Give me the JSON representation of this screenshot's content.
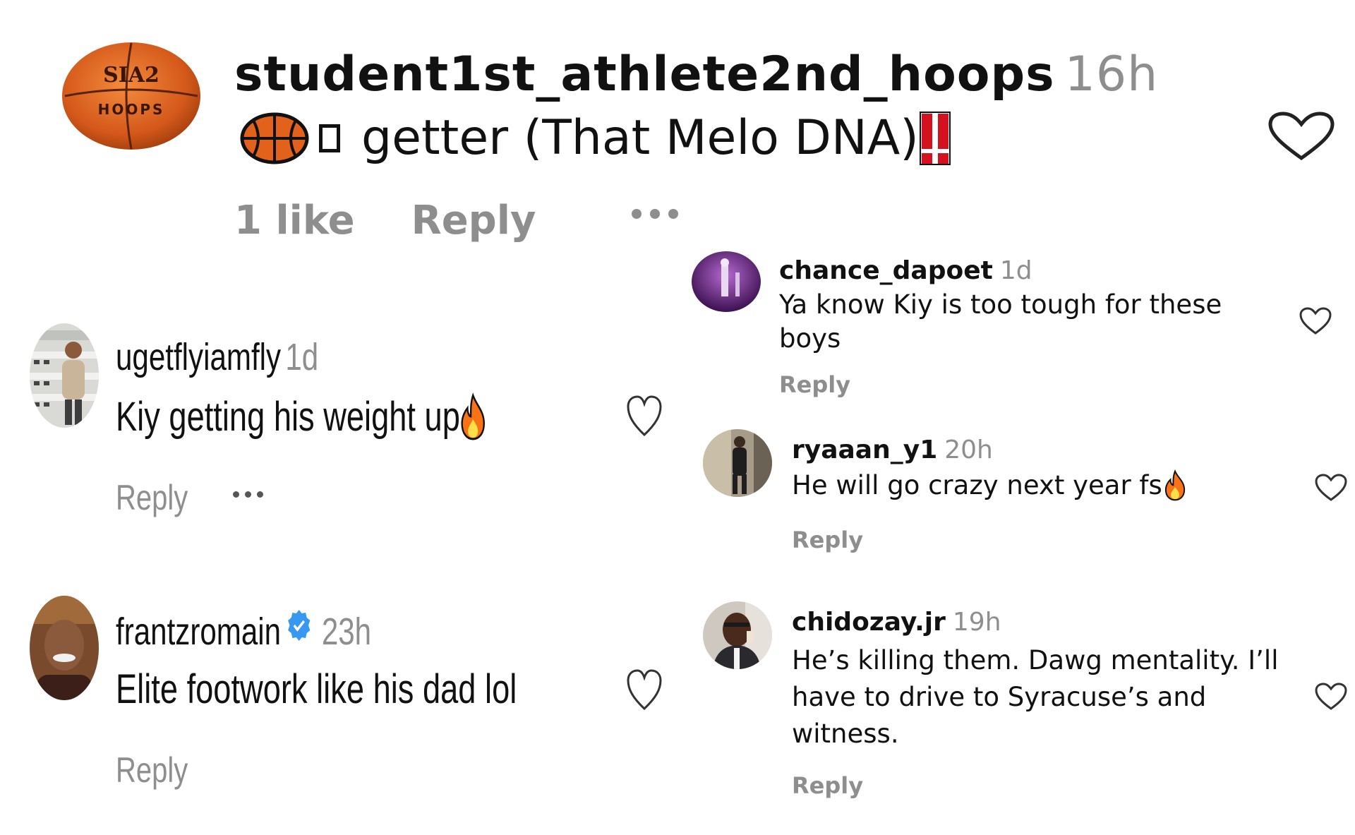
{
  "post": {
    "username": "student1st_athlete2nd_hoops",
    "timestamp": "16h",
    "caption": "getter (That Melo DNA)",
    "likes": "1 like",
    "reply_label": "Reply",
    "avatar_logo_top": "SIA2",
    "avatar_logo_bottom": "HOOPS",
    "icon_more": "more-icon",
    "icon_like": "heart-icon"
  },
  "left_comments": [
    {
      "username": "ugetflyiamfly",
      "timestamp": "1d",
      "text": "Kiy getting his weight up",
      "reply_label": "Reply",
      "emoji": "fire-icon"
    },
    {
      "username": "frantzromain",
      "timestamp": "23h",
      "text": "Elite footwork like his dad lol",
      "reply_label": "Reply",
      "verified": true
    }
  ],
  "right_comments": [
    {
      "username": "chance_dapoet",
      "timestamp": "1d",
      "text": "Ya know Kiy is too tough for these boys",
      "reply_label": "Reply"
    },
    {
      "username": "ryaaan_y1",
      "timestamp": "20h",
      "text": "He will go crazy next year fs",
      "reply_label": "Reply",
      "emoji": "fire-icon"
    },
    {
      "username": "chidozay.jr",
      "timestamp": "19h",
      "text": "He’s killing them. Dawg mentality. I’ll have to drive to Syracuse’s and witness.",
      "reply_label": "Reply"
    }
  ],
  "colors": {
    "text": "#111111",
    "muted": "#8e8e8e",
    "verified": "#3897f0",
    "basketball": "#e2621b",
    "fire": "#f97316"
  }
}
